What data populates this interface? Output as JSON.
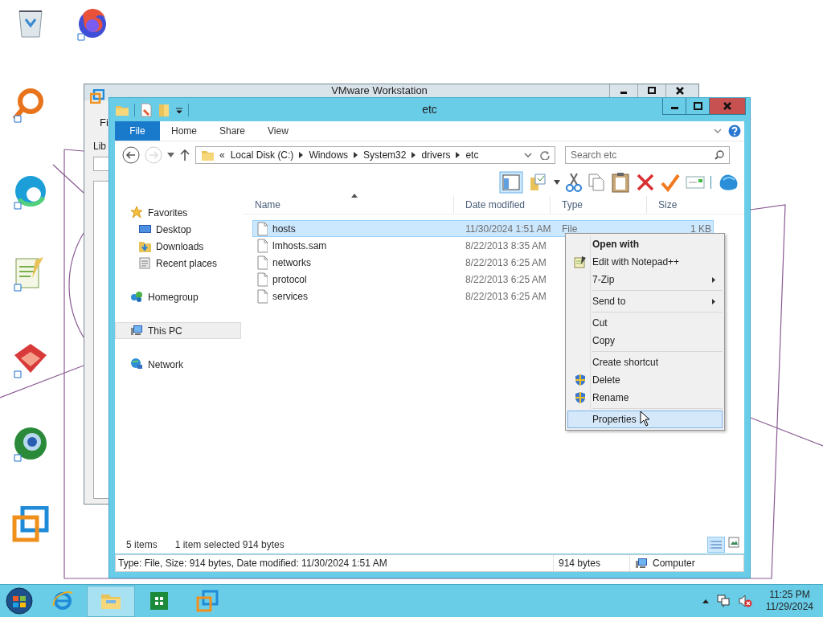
{
  "background_window": {
    "title": "VMware Workstation",
    "menu_item": "Fi",
    "pane_label": "Lib"
  },
  "window": {
    "title": "etc",
    "ribbon_tabs": [
      {
        "label": "File",
        "kind": "file",
        "selected": false
      },
      {
        "label": "Home",
        "kind": "tab",
        "selected": false
      },
      {
        "label": "Share",
        "kind": "tab",
        "selected": false
      },
      {
        "label": "View",
        "kind": "tab",
        "selected": false
      }
    ],
    "address": {
      "overflow": "«",
      "segments": [
        "Local Disk (C:)",
        "Windows",
        "System32",
        "drivers",
        "etc"
      ]
    },
    "search": {
      "placeholder": "Search etc"
    },
    "navigation": [
      {
        "label": "Favorites",
        "kind": "favorites",
        "selected": false,
        "children": [
          {
            "label": "Desktop",
            "kind": "desktop",
            "selected": false
          },
          {
            "label": "Downloads",
            "kind": "downloads",
            "selected": false
          },
          {
            "label": "Recent places",
            "kind": "recent",
            "selected": false
          }
        ]
      },
      {
        "label": "Homegroup",
        "kind": "homegroup",
        "selected": false
      },
      {
        "label": "This PC",
        "kind": "pc",
        "selected": true
      },
      {
        "label": "Network",
        "kind": "network",
        "selected": false
      }
    ],
    "columns": [
      "Name",
      "Date modified",
      "Type",
      "Size"
    ],
    "rows": [
      {
        "name": "hosts",
        "date": "11/30/2024 1:51 AM",
        "type": "File",
        "size": "1 KB",
        "selected": true
      },
      {
        "name": "lmhosts.sam",
        "date": "8/22/2013 8:35 AM",
        "selected": false
      },
      {
        "name": "networks",
        "date": "8/22/2013 6:25 AM",
        "selected": false
      },
      {
        "name": "protocol",
        "date": "8/22/2013 6:25 AM",
        "selected": false
      },
      {
        "name": "services",
        "date": "8/22/2013 6:25 AM",
        "selected": false
      }
    ],
    "status": {
      "items": "5 items",
      "selection": "1 item selected  914 bytes"
    },
    "details_bar": {
      "info": "Type: File, Size: 914 bytes, Date modified: 11/30/2024 1:51 AM",
      "size": "914 bytes",
      "location": "Computer"
    }
  },
  "context_menu": [
    {
      "label": "Open with",
      "kind": "default",
      "selected": false
    },
    {
      "label": "Edit with Notepad++",
      "kind": "notepad",
      "selected": false
    },
    {
      "label": "7-Zip",
      "kind": "submenu",
      "selected": false
    },
    {
      "kind": "separator"
    },
    {
      "label": "Send to",
      "kind": "submenu",
      "selected": false
    },
    {
      "kind": "separator"
    },
    {
      "label": "Cut",
      "kind": "command",
      "selected": false
    },
    {
      "label": "Copy",
      "kind": "command",
      "selected": false
    },
    {
      "kind": "separator"
    },
    {
      "label": "Create shortcut",
      "kind": "command",
      "selected": false
    },
    {
      "label": "Delete",
      "kind": "shield",
      "selected": false
    },
    {
      "label": "Rename",
      "kind": "shield",
      "selected": false
    },
    {
      "kind": "separator"
    },
    {
      "label": "Properties",
      "kind": "command",
      "selected": true
    }
  ],
  "taskbar": {
    "buttons": [
      {
        "kind": "ie",
        "selected": false
      },
      {
        "kind": "explorer",
        "selected": true
      },
      {
        "kind": "store",
        "selected": false
      },
      {
        "kind": "vmware",
        "selected": false
      }
    ],
    "time": "11:25 PM",
    "date": "11/29/2024"
  }
}
